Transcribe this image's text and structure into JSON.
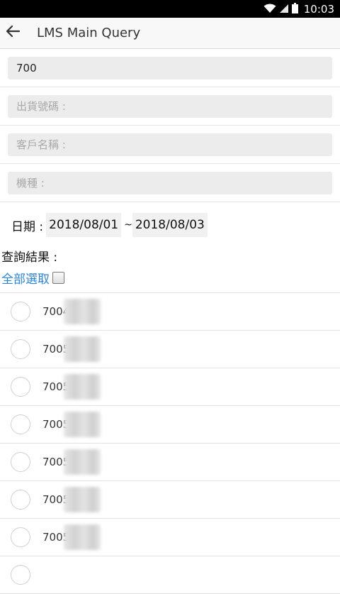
{
  "status_bar": {
    "time": "10:03",
    "icons": [
      "wifi-icon",
      "signal-icon",
      "battery-icon"
    ]
  },
  "app_bar": {
    "back_icon": "arrow-left-icon",
    "title": "LMS Main Query"
  },
  "form": {
    "query_value": "700",
    "shipment_no_placeholder": "出貨號碼 :",
    "customer_name_placeholder": "客戶名稱 :",
    "model_placeholder": "機種 :"
  },
  "date_range": {
    "label": "日期 :",
    "start": "2018/08/01",
    "separator": "~",
    "end": "2018/08/03"
  },
  "results": {
    "label": "查詢結果 :",
    "select_all": "全部選取",
    "items": [
      {
        "text": "7004"
      },
      {
        "text": "7005"
      },
      {
        "text": "7005"
      },
      {
        "text": "7005"
      },
      {
        "text": "7005"
      },
      {
        "text": "7005"
      },
      {
        "text": "7005"
      },
      {
        "text": ""
      }
    ]
  },
  "colors": {
    "link_blue": "#2c84d6",
    "field_bg": "#ececec",
    "status_bar": "#000000"
  }
}
